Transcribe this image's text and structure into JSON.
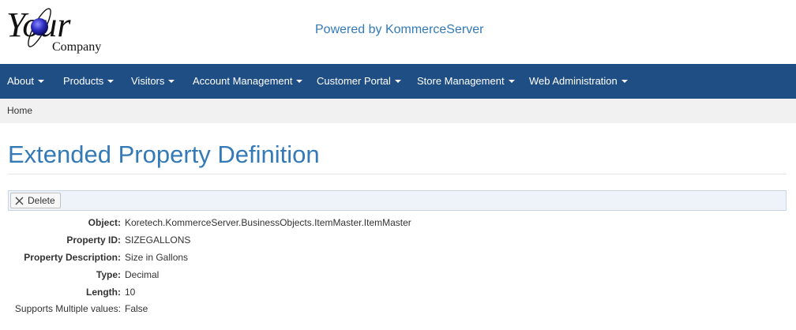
{
  "header": {
    "logo_text_main": "Your",
    "logo_text_sub": "Company",
    "powered_by": "Powered by KommerceServer"
  },
  "nav": {
    "items": [
      {
        "label": "About"
      },
      {
        "label": "Products"
      },
      {
        "label": "Visitors"
      },
      {
        "label": "Account Management"
      },
      {
        "label": "Customer Portal"
      },
      {
        "label": "Store Management"
      },
      {
        "label": "Web Administration"
      }
    ]
  },
  "breadcrumb": {
    "home": "Home"
  },
  "page": {
    "title": "Extended Property Definition"
  },
  "toolbar": {
    "delete_label": "Delete"
  },
  "properties": [
    {
      "label": "Object:",
      "value": "Koretech.KommerceServer.BusinessObjects.ItemMaster.ItemMaster"
    },
    {
      "label": "Property ID:",
      "value": "SIZEGALLONS"
    },
    {
      "label": "Property Description:",
      "value": "Size in Gallons"
    },
    {
      "label": "Type:",
      "value": "Decimal"
    },
    {
      "label": "Length:",
      "value": "10"
    },
    {
      "label": "Supports Multiple values:",
      "value": "False"
    }
  ],
  "colors": {
    "navbar": "#1f4e85",
    "title": "#337ab7",
    "breadcrumb_bg": "#f1f1f1",
    "toolbar_bg": "#eef3fa"
  }
}
